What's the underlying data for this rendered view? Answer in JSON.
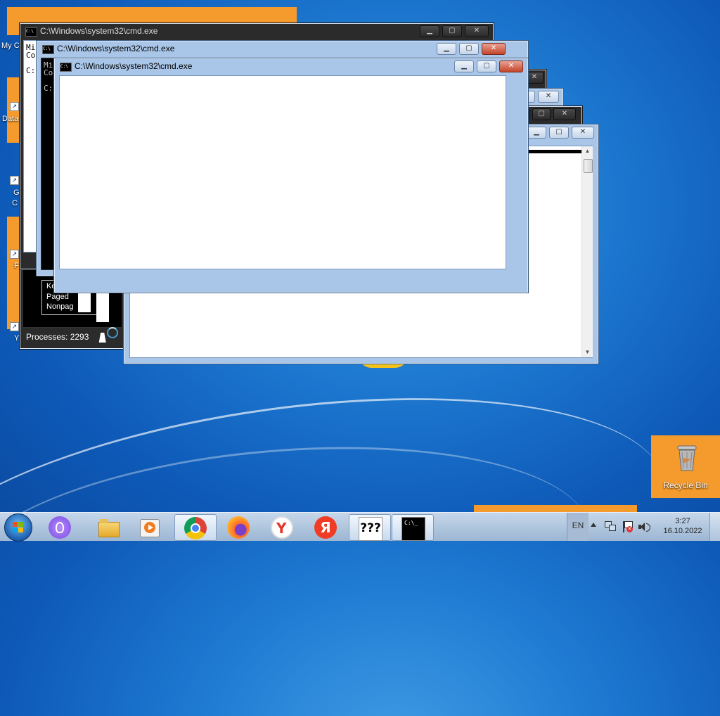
{
  "desktop": {
    "icons": [
      {
        "label": "My C",
        "icon": "my-computer-icon"
      },
      {
        "label": "Data",
        "icon": "shortcut-icon"
      },
      {
        "label": "G",
        "sublabel": "C",
        "icon": "chrome-icon"
      },
      {
        "label": "F",
        "icon": "firefox-icon"
      },
      {
        "label": "Y",
        "icon": "yandex-icon"
      }
    ],
    "recycle_bin": {
      "label": "Recycle Bin",
      "icon": "recycle-bin-icon"
    }
  },
  "windows": {
    "cmd_title": "C:\\Windows\\system32\\cmd.exe",
    "cmd1_lines": "Mi\nCo\n\nC:",
    "cmd2_lines": "Mi\nCo\n\nC:"
  },
  "task_manager": {
    "processes": "Processes: 2293",
    "mem_labels": [
      "Ke",
      "Paged",
      "Nonpag"
    ]
  },
  "taskbar": {
    "buttons": [
      {
        "name": "alice-icon"
      },
      {
        "name": "file-explorer-icon"
      },
      {
        "name": "media-player-icon"
      },
      {
        "name": "chrome-icon"
      },
      {
        "name": "firefox-icon"
      },
      {
        "name": "yandex-browser-icon"
      },
      {
        "name": "yandex-icon",
        "label": "Я"
      },
      {
        "name": "unknown-app-icon",
        "label": "???"
      },
      {
        "name": "cmd-icon",
        "label": "C:\\_"
      }
    ],
    "language": "EN",
    "time": "3:27",
    "date": "16.10.2022"
  },
  "colors": {
    "wallpaper": "#1f7bd2",
    "orange": "#f59a2c",
    "window_frame": "#a9c6e8"
  }
}
